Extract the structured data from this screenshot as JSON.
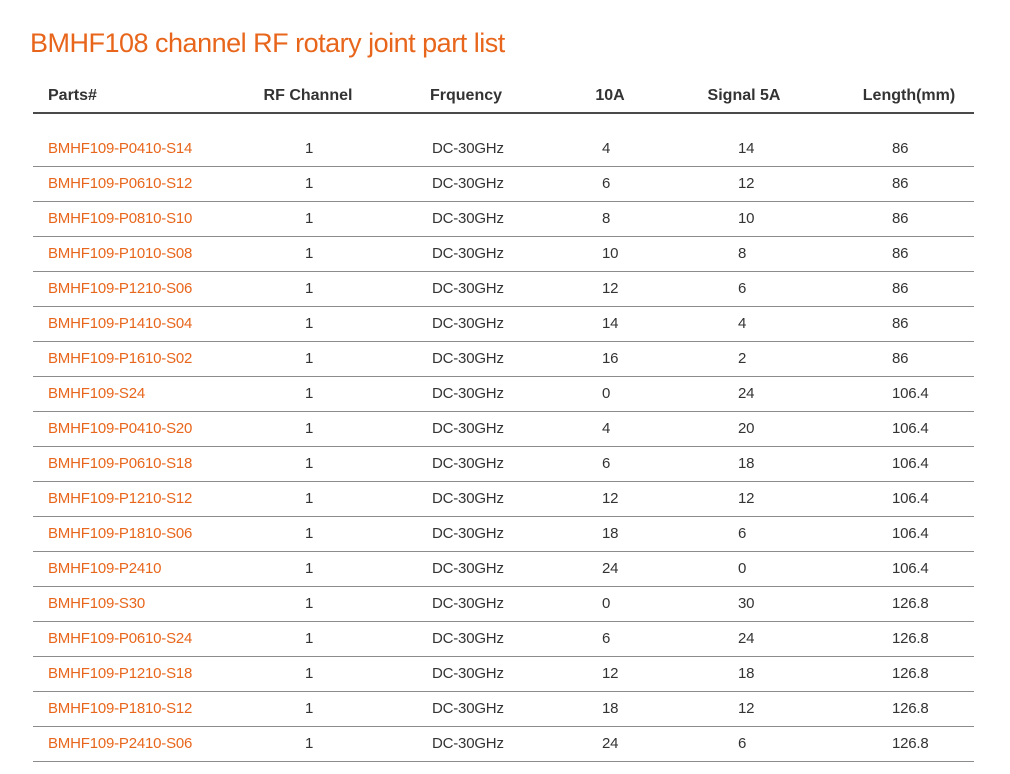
{
  "title": "BMHF108 channel RF rotary joint part list",
  "table": {
    "headers": [
      "Parts#",
      "RF Channel",
      "Frquency",
      "10A",
      "Signal 5A",
      "Length(mm)"
    ],
    "rows": [
      [
        "BMHF109-P0410-S14",
        "1",
        "DC-30GHz",
        "4",
        "14",
        "86"
      ],
      [
        "BMHF109-P0610-S12",
        "1",
        "DC-30GHz",
        "6",
        "12",
        "86"
      ],
      [
        "BMHF109-P0810-S10",
        "1",
        "DC-30GHz",
        "8",
        "10",
        "86"
      ],
      [
        "BMHF109-P1010-S08",
        "1",
        "DC-30GHz",
        "10",
        "8",
        "86"
      ],
      [
        "BMHF109-P1210-S06",
        "1",
        "DC-30GHz",
        "12",
        "6",
        "86"
      ],
      [
        "BMHF109-P1410-S04",
        "1",
        "DC-30GHz",
        "14",
        "4",
        "86"
      ],
      [
        "BMHF109-P1610-S02",
        "1",
        "DC-30GHz",
        "16",
        "2",
        "86"
      ],
      [
        "BMHF109-S24",
        "1",
        "DC-30GHz",
        "0",
        "24",
        "106.4"
      ],
      [
        "BMHF109-P0410-S20",
        "1",
        "DC-30GHz",
        "4",
        "20",
        "106.4"
      ],
      [
        "BMHF109-P0610-S18",
        "1",
        "DC-30GHz",
        "6",
        "18",
        "106.4"
      ],
      [
        "BMHF109-P1210-S12",
        "1",
        "DC-30GHz",
        "12",
        "12",
        "106.4"
      ],
      [
        "BMHF109-P1810-S06",
        "1",
        "DC-30GHz",
        "18",
        "6",
        "106.4"
      ],
      [
        "BMHF109-P2410",
        "1",
        "DC-30GHz",
        "24",
        "0",
        "106.4"
      ],
      [
        "BMHF109-S30",
        "1",
        "DC-30GHz",
        "0",
        "30",
        "126.8"
      ],
      [
        "BMHF109-P0610-S24",
        "1",
        "DC-30GHz",
        "6",
        "24",
        "126.8"
      ],
      [
        "BMHF109-P1210-S18",
        "1",
        "DC-30GHz",
        "12",
        "18",
        "126.8"
      ],
      [
        "BMHF109-P1810-S12",
        "1",
        "DC-30GHz",
        "18",
        "12",
        "126.8"
      ],
      [
        "BMHF109-P2410-S06",
        "1",
        "DC-30GHz",
        "24",
        "6",
        "126.8"
      ]
    ]
  },
  "colors": {
    "accent": "#e8661c",
    "text": "#333333",
    "rule": "#8c8c8c"
  }
}
